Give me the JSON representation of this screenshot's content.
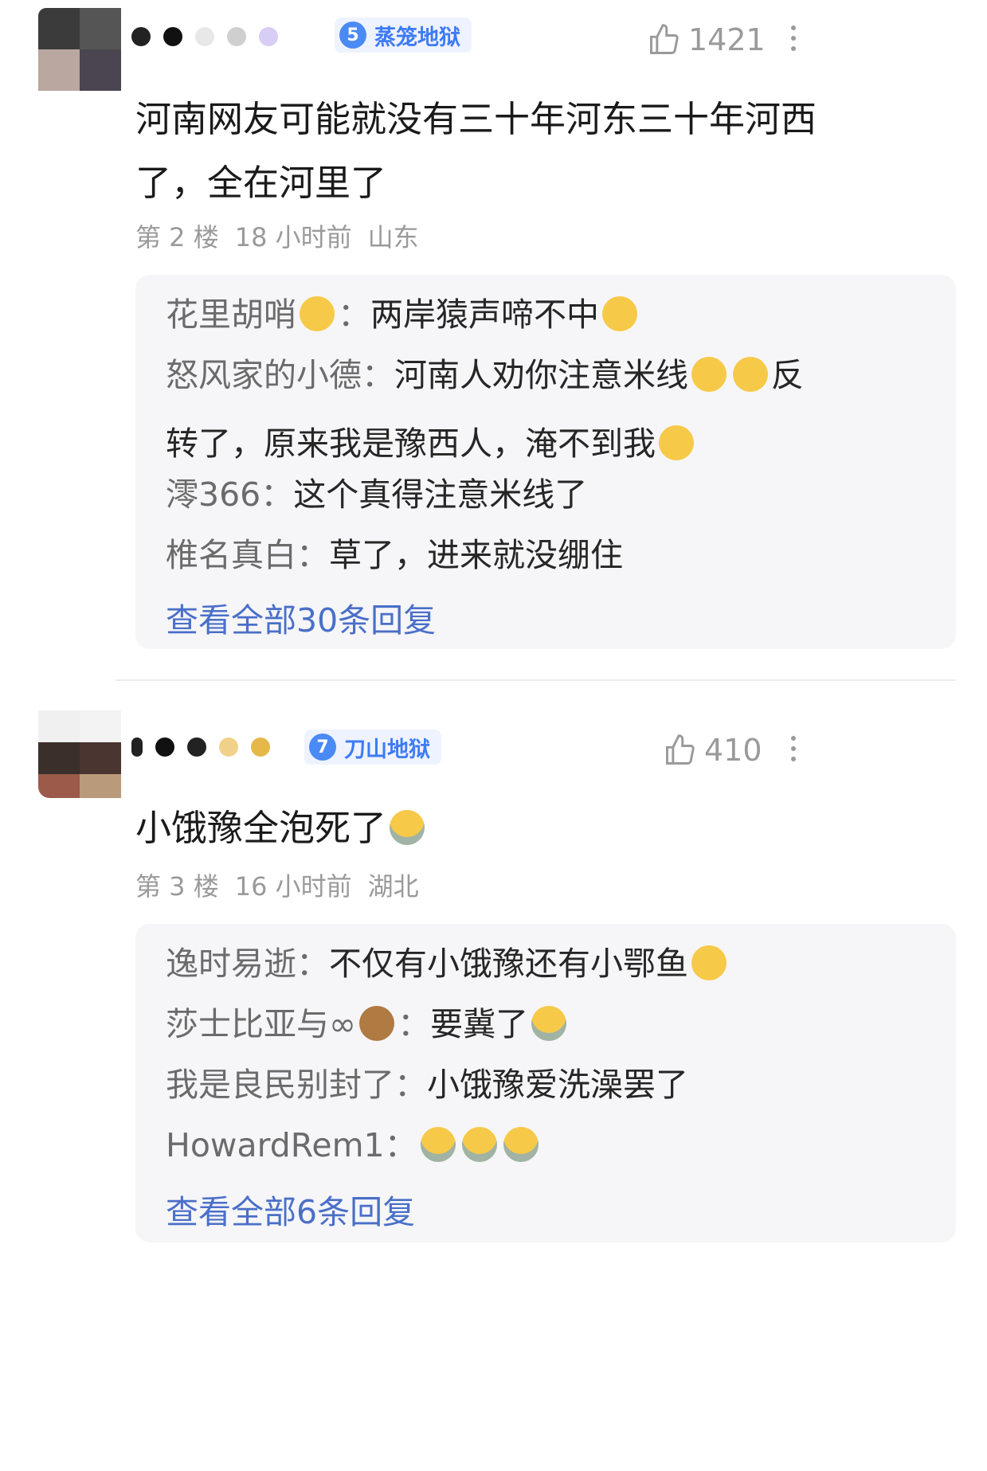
{
  "comments": [
    {
      "level_number": "5",
      "level_title": "蒸笼地狱",
      "like_count": "1421",
      "text_line1": "河南网友可能就没有三十年河东三十年河西",
      "text_line2": "了，全在河里了",
      "floor": "第 2 楼",
      "time": "18 小时前",
      "location": "山东",
      "replies": [
        {
          "name": "花里胡哨",
          "text": "两岸猿声啼不中"
        },
        {
          "name": "怒风家的小德",
          "text": "河南人劝你注意米线",
          "suffix": "反",
          "continuation": "转了，原来我是豫西人，淹不到我"
        },
        {
          "name": "澪366",
          "text": "这个真得注意米线了"
        },
        {
          "name": "椎名真白",
          "text": "草了，进来就没绷住"
        }
      ],
      "view_all": "查看全部30条回复"
    },
    {
      "level_number": "7",
      "level_title": "刀山地狱",
      "like_count": "410",
      "text_line1": "小饿豫全泡死了",
      "floor": "第 3 楼",
      "time": "16 小时前",
      "location": "湖北",
      "replies": [
        {
          "name": "逸时易逝",
          "text": "不仅有小饿豫还有小鄂鱼"
        },
        {
          "name": "莎士比亚与∞",
          "text": "要冀了"
        },
        {
          "name": "我是良民别封了",
          "text": "小饿豫爱洗澡罢了"
        },
        {
          "name": "HowardRem1",
          "text": ""
        }
      ],
      "view_all": "查看全部6条回复"
    }
  ],
  "separator": "：",
  "icons": {
    "like": "thumbs-up-icon",
    "more": "more-vertical-icon",
    "level": "level-diamond-icon"
  },
  "colors": {
    "link": "#4a6fc8",
    "badge_text": "#3d7bf5",
    "meta": "#9a9a9a",
    "reply_bg": "#f6f6f8"
  }
}
